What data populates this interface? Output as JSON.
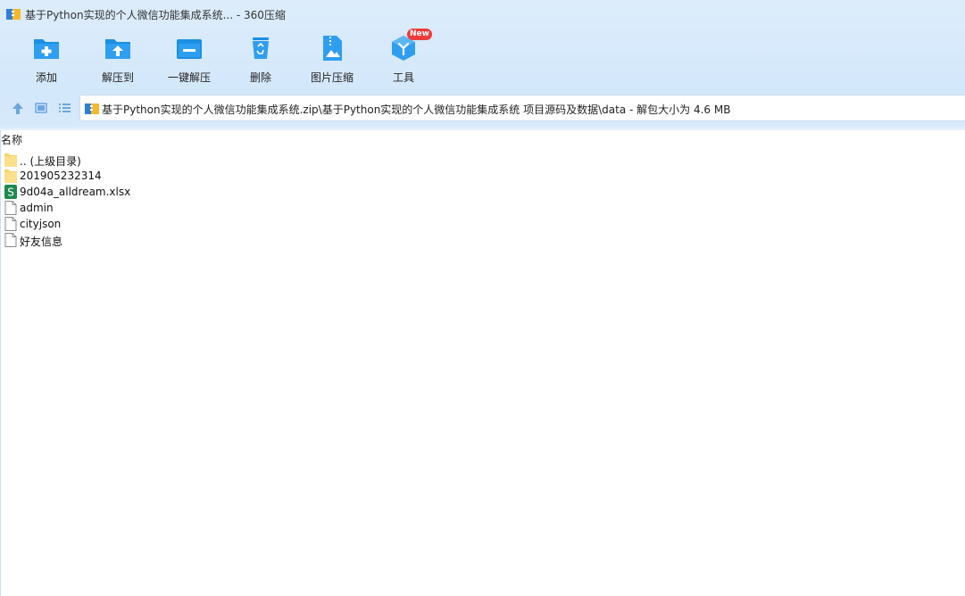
{
  "window": {
    "title": "基于Python实现的个人微信功能集成系统... - 360压缩"
  },
  "toolbar": {
    "items": [
      {
        "label": "添加",
        "icon": "add-folder-icon"
      },
      {
        "label": "解压到",
        "icon": "extract-to-icon"
      },
      {
        "label": "一键解压",
        "icon": "one-click-extract-icon"
      },
      {
        "label": "删除",
        "icon": "recycle-bin-icon"
      },
      {
        "label": "图片压缩",
        "icon": "image-compress-icon"
      },
      {
        "label": "工具",
        "icon": "tools-cube-icon",
        "badge": "New"
      }
    ]
  },
  "pathbar": {
    "path": "基于Python实现的个人微信功能集成系统.zip\\基于Python实现的个人微信功能集成系统 项目源码及数据\\data - 解包大小为 4.6 MB"
  },
  "list": {
    "column_name": "名称",
    "items": [
      {
        "name": ".. (上级目录)",
        "type": "folder"
      },
      {
        "name": "201905232314",
        "type": "folder"
      },
      {
        "name": "9d04a_alldream.xlsx",
        "type": "spreadsheet"
      },
      {
        "name": "admin",
        "type": "file"
      },
      {
        "name": "cityjson",
        "type": "file"
      },
      {
        "name": "好友信息",
        "type": "file"
      }
    ]
  },
  "colors": {
    "accent": "#1a8fe3",
    "header_bg": "#d6e9fb",
    "folder": "#f7d36b",
    "xlsx": "#1d8a4e",
    "badge": "#ee3b3b"
  }
}
